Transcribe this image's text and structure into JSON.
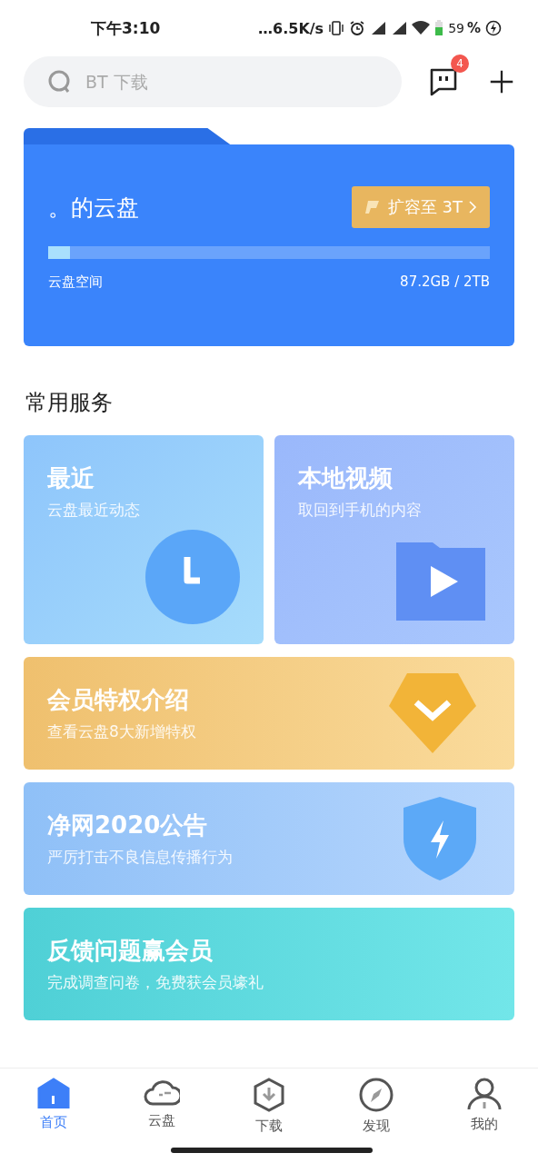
{
  "status_bar": {
    "time": "下午3:10",
    "speed": "…6.5K/s",
    "battery": "59",
    "percent": "%"
  },
  "header": {
    "search": {
      "placeholder": "BT 下载"
    },
    "message_badge": "4"
  },
  "cloud_card": {
    "title": "。的云盘",
    "upgrade_button": "扩容至 3T",
    "storage_label": "云盘空间",
    "storage_reading": "87.2GB / 2TB",
    "level": 0.05
  },
  "section_title": "常用服务",
  "tiles": [
    {
      "title": "最近",
      "subtitle": "云盘最近动态"
    },
    {
      "title": "本地视频",
      "subtitle": "取回到手机的内容"
    }
  ],
  "banners": [
    {
      "title": "会员特权介绍",
      "subtitle": "查看云盘8大新增特权"
    },
    {
      "title": "净网2020公告",
      "subtitle": "严厉打击不良信息传播行为"
    },
    {
      "title": "反馈问题赢会员",
      "subtitle": "完成调查问卷，免费获会员壕礼"
    }
  ],
  "tab_bar": [
    {
      "label": "首页",
      "selected": true
    },
    {
      "label": "云盘",
      "selected": false
    },
    {
      "label": "下载",
      "selected": false
    },
    {
      "label": "发现",
      "selected": false
    },
    {
      "label": "我的",
      "selected": false
    }
  ]
}
